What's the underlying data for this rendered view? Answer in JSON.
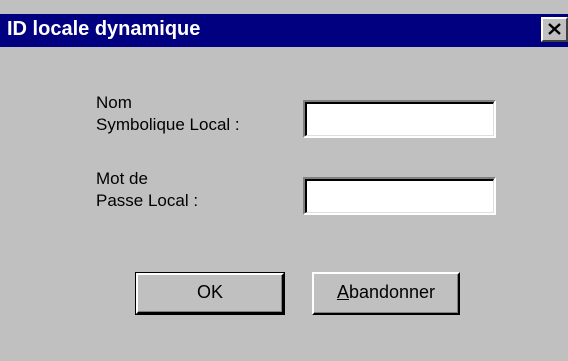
{
  "dialog": {
    "title": "ID locale dynamique",
    "close_icon": "close-icon"
  },
  "fields": {
    "name_label": "Nom\nSymbolique Local :",
    "name_value": "",
    "password_label": "Mot de\nPasse Local :",
    "password_value": ""
  },
  "buttons": {
    "ok_label": "OK",
    "abandon_accel": "A",
    "abandon_rest": "bandonner"
  }
}
